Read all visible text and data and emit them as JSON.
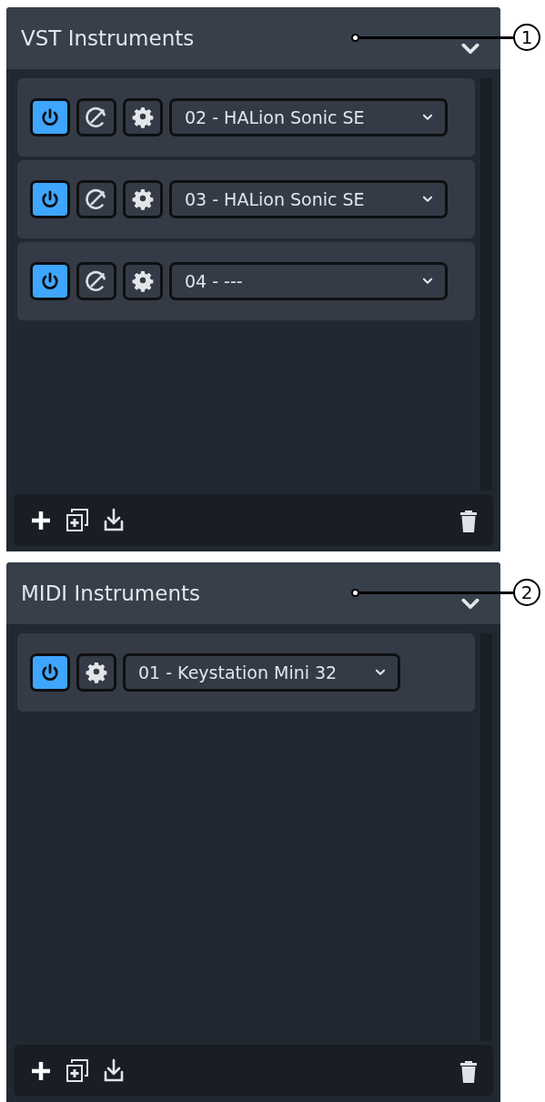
{
  "panels": [
    {
      "title": "VST Instruments",
      "expanded": true,
      "callout": "1",
      "instruments": [
        {
          "name": "02 - HALion Sonic SE",
          "on": true,
          "editor": true
        },
        {
          "name": "03 - HALion Sonic SE",
          "on": true,
          "editor": true
        },
        {
          "name": "04 - ---",
          "on": true,
          "editor": true
        }
      ]
    },
    {
      "title": "MIDI Instruments",
      "expanded": true,
      "callout": "2",
      "instruments": [
        {
          "name": "01 - Keystation Mini 32",
          "on": true,
          "editor": false
        }
      ]
    }
  ]
}
